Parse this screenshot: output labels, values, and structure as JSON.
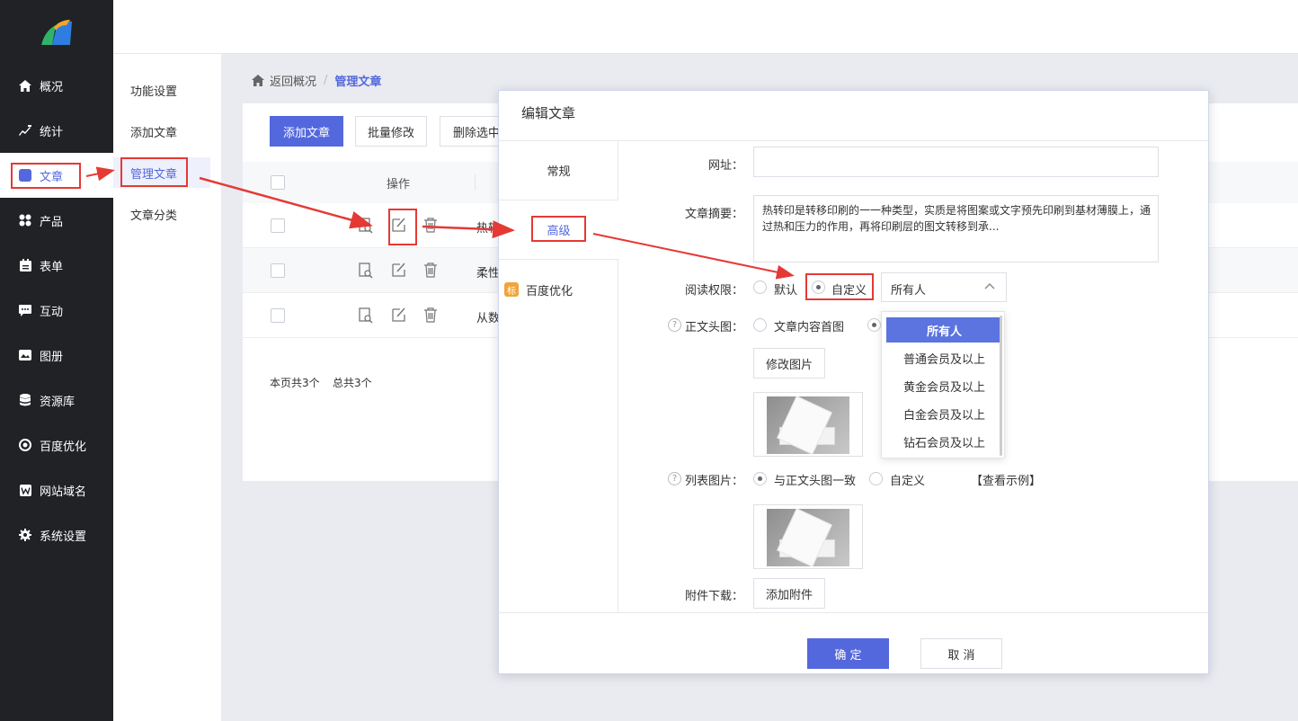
{
  "sidebar": {
    "items": [
      {
        "label": "概况",
        "icon": "home-icon"
      },
      {
        "label": "统计",
        "icon": "chart-icon"
      },
      {
        "label": "文章",
        "icon": "article-icon"
      },
      {
        "label": "产品",
        "icon": "grid-icon"
      },
      {
        "label": "表单",
        "icon": "form-icon"
      },
      {
        "label": "互动",
        "icon": "chat-icon"
      },
      {
        "label": "图册",
        "icon": "album-icon"
      },
      {
        "label": "资源库",
        "icon": "database-icon"
      },
      {
        "label": "百度优化",
        "icon": "seo-icon"
      },
      {
        "label": "网站域名",
        "icon": "domain-icon"
      },
      {
        "label": "系统设置",
        "icon": "gear-icon"
      }
    ],
    "active": "文章"
  },
  "submenu": {
    "items": [
      "功能设置",
      "添加文章",
      "管理文章",
      "文章分类"
    ],
    "active": "管理文章"
  },
  "breadcrumb": {
    "back": "返回概况",
    "separator": "/",
    "current": "管理文章"
  },
  "toolbar": {
    "add": "添加文章",
    "batch_edit": "批量修改",
    "delete_selected": "删除选中"
  },
  "table": {
    "op_header": "操作",
    "rows": [
      {
        "title": "热转"
      },
      {
        "title": "柔性"
      },
      {
        "title": "从数"
      }
    ],
    "footer_page": "本页共3个",
    "footer_total": "总共3个"
  },
  "modal": {
    "title": "编辑文章",
    "tabs": [
      "常规",
      "高级",
      "百度优化"
    ],
    "tab_badge": "标",
    "active_tab": "高级",
    "url_label": "网址：",
    "url_value": "",
    "summary_label": "文章摘要：",
    "summary_text": "热转印是转移印刷的一一种类型，实质是将图案或文字预先印刷到基材薄膜上，通过热和压力的作用，再将印刷层的图文转移到承...",
    "read_perm_label": "阅读权限：",
    "read_perm_options": [
      "默认",
      "自定义"
    ],
    "read_perm_selected": "自定义",
    "read_perm_select_value": "所有人",
    "dropdown_options": [
      "所有人",
      "普通会员及以上",
      "黄金会员及以上",
      "白金会员及以上",
      "钻石会员及以上"
    ],
    "header_img_label": "正文头图：",
    "header_img_option": "文章内容首图",
    "change_img_btn": "修改图片",
    "list_img_label": "列表图片：",
    "list_img_options": [
      "与正文头图一致",
      "自定义"
    ],
    "list_img_selected": "与正文头图一致",
    "view_example": "【查看示例】",
    "attachment_label": "附件下载：",
    "add_attachment_btn": "添加附件",
    "confirm": "确 定",
    "cancel": "取 消"
  },
  "colors": {
    "accent": "#5468dd",
    "sidebar_bg": "#202226",
    "annotation": "#e53935"
  }
}
